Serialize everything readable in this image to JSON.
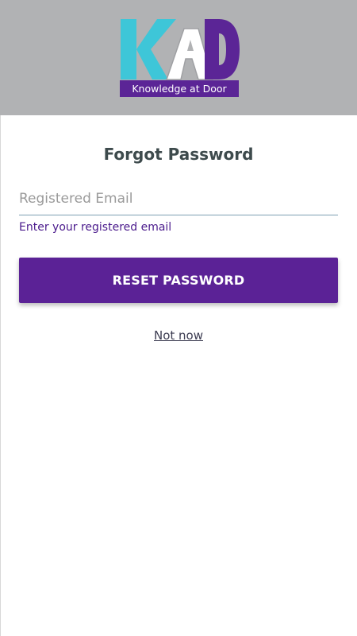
{
  "header": {
    "background_color": "#b1b2b4",
    "logo": {
      "letters": "KAD",
      "tagline": "Knowledge at Door",
      "colors": {
        "k": "#3ec6d8",
        "a": "#ffffff",
        "d": "#5b2596",
        "tagline_bg": "#5b2596"
      }
    }
  },
  "form": {
    "title": "Forgot Password",
    "email_placeholder": "Registered Email",
    "email_value": "",
    "helper_text": "Enter your registered email",
    "reset_button_label": "RESET PASSWORD",
    "not_now_label": "Not now"
  },
  "colors": {
    "accent": "#5b2296",
    "helper_text": "#4a1a8c",
    "title_text": "#3d4a4c",
    "input_underline": "#7e9fb2"
  }
}
